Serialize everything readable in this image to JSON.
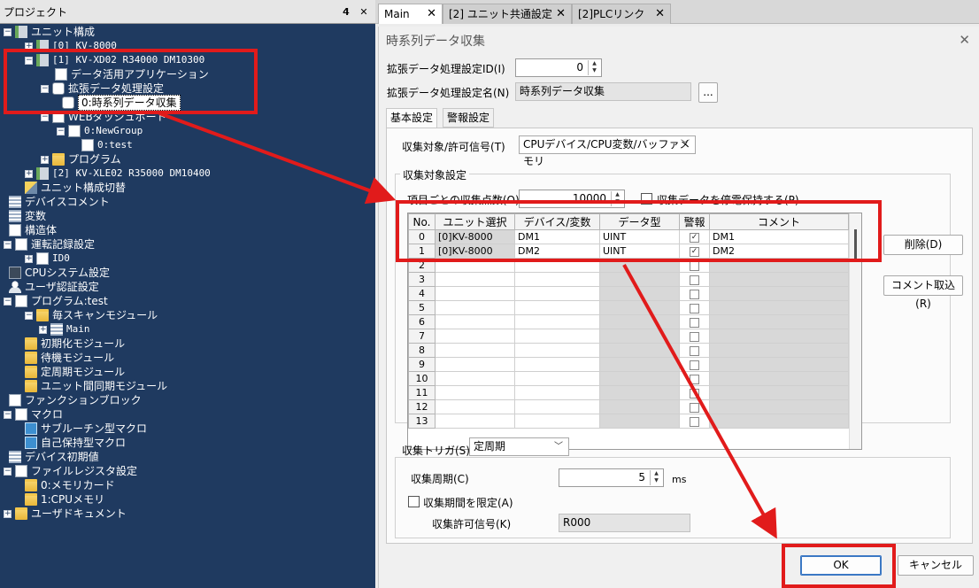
{
  "project_panel": {
    "title": "プロジェクト",
    "pin_glyph": "𝟰",
    "close_glyph": "✕",
    "tree": [
      {
        "label": "ユニット構成",
        "icon": "unit-config-icon",
        "exp": "−"
      },
      {
        "label": "[0]  KV-8000",
        "icon": "unit-icon",
        "exp": "+"
      },
      {
        "label": "[1]  KV-XD02     R34000  DM10300",
        "icon": "unit-icon",
        "exp": "−"
      },
      {
        "label": "データ活用アプリケーション",
        "icon": "app-icon",
        "exp": ""
      },
      {
        "label": "拡張データ処理設定",
        "icon": "settings-icon",
        "exp": "−"
      },
      {
        "label": "0:時系列データ収集",
        "icon": "gear-icon",
        "exp": ""
      },
      {
        "label": "WEBダッシュボード",
        "icon": "dashboard-icon",
        "exp": "−"
      },
      {
        "label": "0:NewGroup",
        "icon": "chart-icon",
        "exp": "−"
      },
      {
        "label": "0:test",
        "icon": "monitor-icon",
        "exp": ""
      },
      {
        "label": "プログラム",
        "icon": "folder-icon",
        "exp": "+"
      },
      {
        "label": "[2]  KV-XLE02     R35000  DM10400",
        "icon": "unit-icon",
        "exp": "+"
      },
      {
        "label": "ユニット構成切替",
        "icon": "switch-icon",
        "exp": ""
      },
      {
        "label": "デバイスコメント",
        "icon": "comment-icon",
        "exp": ""
      },
      {
        "label": "変数",
        "icon": "variable-icon",
        "exp": ""
      },
      {
        "label": "構造体",
        "icon": "struct-icon",
        "exp": ""
      },
      {
        "label": "運転記録設定",
        "icon": "record-icon",
        "exp": "−"
      },
      {
        "label": "ID0",
        "icon": "id-icon",
        "exp": "+"
      },
      {
        "label": "CPUシステム設定",
        "icon": "cpu-icon",
        "exp": ""
      },
      {
        "label": "ユーザ認証設定",
        "icon": "user-icon",
        "exp": ""
      },
      {
        "label": "プログラム:test",
        "icon": "program-icon",
        "exp": "−"
      },
      {
        "label": "毎スキャンモジュール",
        "icon": "folder-icon",
        "exp": "−"
      },
      {
        "label": "Main",
        "icon": "ladder-icon",
        "exp": "+"
      },
      {
        "label": "初期化モジュール",
        "icon": "folder-icon",
        "exp": ""
      },
      {
        "label": "待機モジュール",
        "icon": "folder-icon",
        "exp": ""
      },
      {
        "label": "定周期モジュール",
        "icon": "folder-icon",
        "exp": ""
      },
      {
        "label": "ユニット間同期モジュール",
        "icon": "folder-icon",
        "exp": ""
      },
      {
        "label": "ファンクションブロック",
        "icon": "function-block-icon",
        "exp": ""
      },
      {
        "label": "マクロ",
        "icon": "macro-icon",
        "exp": "−"
      },
      {
        "label": "サブルーチン型マクロ",
        "icon": "macro-sub-icon",
        "exp": ""
      },
      {
        "label": "自己保持型マクロ",
        "icon": "macro-self-icon",
        "exp": ""
      },
      {
        "label": "デバイス初期値",
        "icon": "device-init-icon",
        "exp": ""
      },
      {
        "label": "ファイルレジスタ設定",
        "icon": "file-register-icon",
        "exp": "−"
      },
      {
        "label": "0:メモリカード",
        "icon": "folder-icon",
        "exp": ""
      },
      {
        "label": "1:CPUメモリ",
        "icon": "folder-icon",
        "exp": ""
      },
      {
        "label": "ユーザドキュメント",
        "icon": "user-doc-icon",
        "exp": "+"
      }
    ]
  },
  "tabs": [
    {
      "label": "Main",
      "close": "✕"
    },
    {
      "label": "[2] ユニット共通設定",
      "close": "✕"
    },
    {
      "label": "[2]PLCリンク",
      "close": "✕"
    }
  ],
  "dialog": {
    "title": "時系列データ収集",
    "close": "✕",
    "id_label": "拡張データ処理設定ID(I)",
    "id_value": "0",
    "name_label": "拡張データ処理設定名(N)",
    "name_value": "時系列データ収集",
    "browse_label": "...",
    "subtabs": [
      "基本設定",
      "警報設定"
    ],
    "target_label": "収集対象/許可信号(T)",
    "target_value": "CPUデバイス/CPU変数/バッファメモリ",
    "group_title": "収集対象設定",
    "count_label": "項目ごとの収集点数(O)",
    "count_value": "10000",
    "keep_label": "収集データを停電保持する(P)",
    "columns": [
      "No.",
      "ユニット選択",
      "デバイス/変数",
      "データ型",
      "警報",
      "コメント"
    ],
    "rows": [
      {
        "no": "0",
        "unit": "[0]KV-8000",
        "device": "DM1",
        "type": "UINT",
        "alarm": "✓",
        "comment": "DM1"
      },
      {
        "no": "1",
        "unit": "[0]KV-8000",
        "device": "DM2",
        "type": "UINT",
        "alarm": "✓",
        "comment": "DM2"
      },
      {
        "no": "2",
        "unit": "",
        "device": "",
        "type": "",
        "alarm": "",
        "comment": ""
      },
      {
        "no": "3",
        "unit": "",
        "device": "",
        "type": "",
        "alarm": "",
        "comment": ""
      },
      {
        "no": "4",
        "unit": "",
        "device": "",
        "type": "",
        "alarm": "",
        "comment": ""
      },
      {
        "no": "5",
        "unit": "",
        "device": "",
        "type": "",
        "alarm": "",
        "comment": ""
      },
      {
        "no": "6",
        "unit": "",
        "device": "",
        "type": "",
        "alarm": "",
        "comment": ""
      },
      {
        "no": "7",
        "unit": "",
        "device": "",
        "type": "",
        "alarm": "",
        "comment": ""
      },
      {
        "no": "8",
        "unit": "",
        "device": "",
        "type": "",
        "alarm": "",
        "comment": ""
      },
      {
        "no": "9",
        "unit": "",
        "device": "",
        "type": "",
        "alarm": "",
        "comment": ""
      },
      {
        "no": "10",
        "unit": "",
        "device": "",
        "type": "",
        "alarm": "",
        "comment": ""
      },
      {
        "no": "11",
        "unit": "",
        "device": "",
        "type": "",
        "alarm": "",
        "comment": ""
      },
      {
        "no": "12",
        "unit": "",
        "device": "",
        "type": "",
        "alarm": "",
        "comment": ""
      },
      {
        "no": "13",
        "unit": "",
        "device": "",
        "type": "",
        "alarm": "",
        "comment": ""
      }
    ],
    "dots_glyph": "...",
    "delete_label": "削除(D)",
    "import_comment_label": "コメント取込(R)",
    "trigger_label": "収集トリガ(S)",
    "trigger_value": "定周期",
    "period_label": "収集周期(C)",
    "period_value": "5",
    "period_unit": "ms",
    "limit_label": "収集期間を限定(A)",
    "permit_label": "収集許可信号(K)",
    "permit_value": "R000",
    "ok_label": "OK",
    "cancel_label": "キャンセル"
  },
  "colors": {
    "annotation_red": "#e11b1b",
    "tree_background": "#1f3a60"
  }
}
